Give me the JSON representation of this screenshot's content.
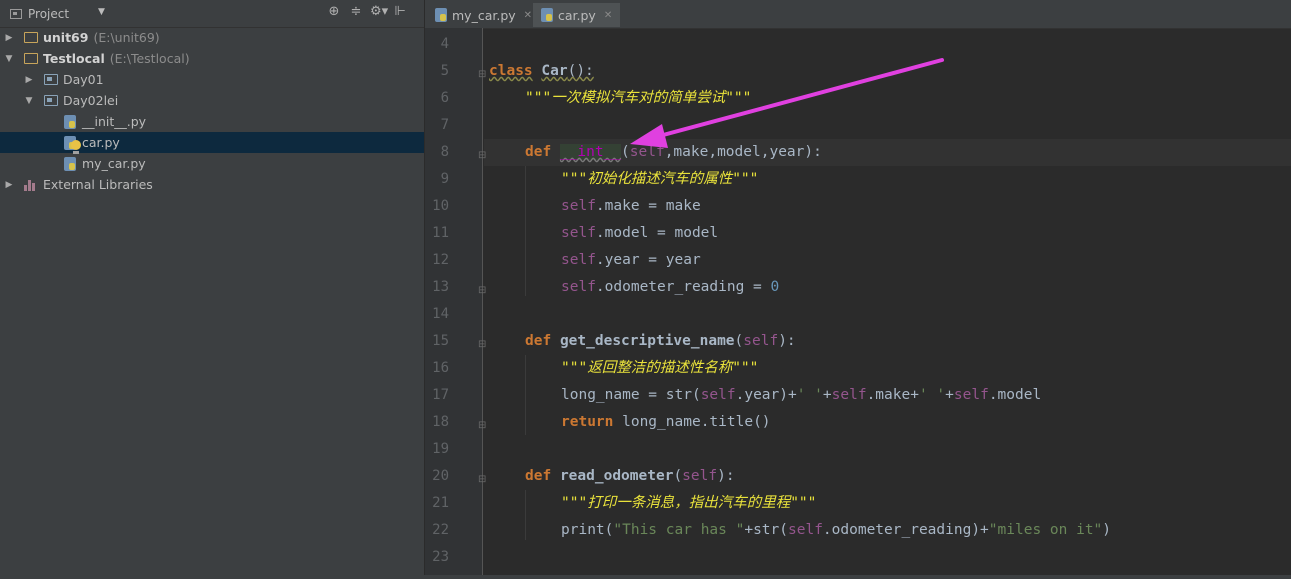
{
  "project_panel": {
    "title": "Project",
    "tree": [
      {
        "name": "unit69",
        "path": "(E:\\unit69)",
        "expanded": false,
        "bold": true
      },
      {
        "name": "Testlocal",
        "path": "(E:\\Testlocal)",
        "expanded": true,
        "bold": true
      },
      {
        "name": "Day01",
        "expanded": false
      },
      {
        "name": "Day02lei",
        "expanded": true
      },
      {
        "name": "__init__.py"
      },
      {
        "name": "car.py",
        "selected": true
      },
      {
        "name": "my_car.py"
      },
      {
        "name": "External Libraries",
        "expanded": false
      }
    ]
  },
  "editor": {
    "tabs": [
      {
        "label": "my_car.py",
        "active": false
      },
      {
        "label": "car.py",
        "active": true
      }
    ],
    "line_numbers": [
      "4",
      "5",
      "6",
      "7",
      "8",
      "9",
      "10",
      "11",
      "12",
      "13",
      "14",
      "15",
      "16",
      "17",
      "18",
      "19",
      "20",
      "21",
      "22",
      "23"
    ],
    "code": {
      "l5_kw": "class",
      "l5_name": "Car",
      "l5_rest": "():",
      "l6_doc": "\"\"\"一次模拟汽车对的简单尝试\"\"\"",
      "l8_kw": "def",
      "l8_fn": "__int__",
      "l8_open": "(",
      "l8_self": "self",
      "l8_params": ",make,model,year):",
      "l9_doc": "\"\"\"初始化描述汽车的属性\"\"\"",
      "l10_self": "self",
      "l10_rest": ".make = make",
      "l11_self": "self",
      "l11_rest": ".model = model",
      "l12_self": "self",
      "l12_rest": ".year = year",
      "l13_self": "self",
      "l13_rest": ".odometer_reading = ",
      "l13_num": "0",
      "l15_kw": "def",
      "l15_fn": "get_descriptive_name",
      "l15_open": "(",
      "l15_self": "self",
      "l15_close": "):",
      "l16_doc": "\"\"\"返回整洁的描述性名称\"\"\"",
      "l17_a": "long_name = str(",
      "l17_self1": "self",
      "l17_b": ".year)+",
      "l17_s1": "' '",
      "l17_c": "+",
      "l17_self2": "self",
      "l17_d": ".make+",
      "l17_s2": "' '",
      "l17_e": "+",
      "l17_self3": "self",
      "l17_f": ".model",
      "l18_kw": "return",
      "l18_rest": " long_name.title()",
      "l20_kw": "def",
      "l20_fn": "read_odometer",
      "l20_open": "(",
      "l20_self": "self",
      "l20_close": "):",
      "l21_doc": "\"\"\"打印一条消息，指出汽车的里程\"\"\"",
      "l22_a": "print(",
      "l22_s1": "\"This car has \"",
      "l22_b": "+str(",
      "l22_self": "self",
      "l22_c": ".odometer_reading)+",
      "l22_s2": "\"miles on it\"",
      "l22_d": ")"
    }
  },
  "colors": {
    "annotation_arrow": "#e040e0"
  }
}
